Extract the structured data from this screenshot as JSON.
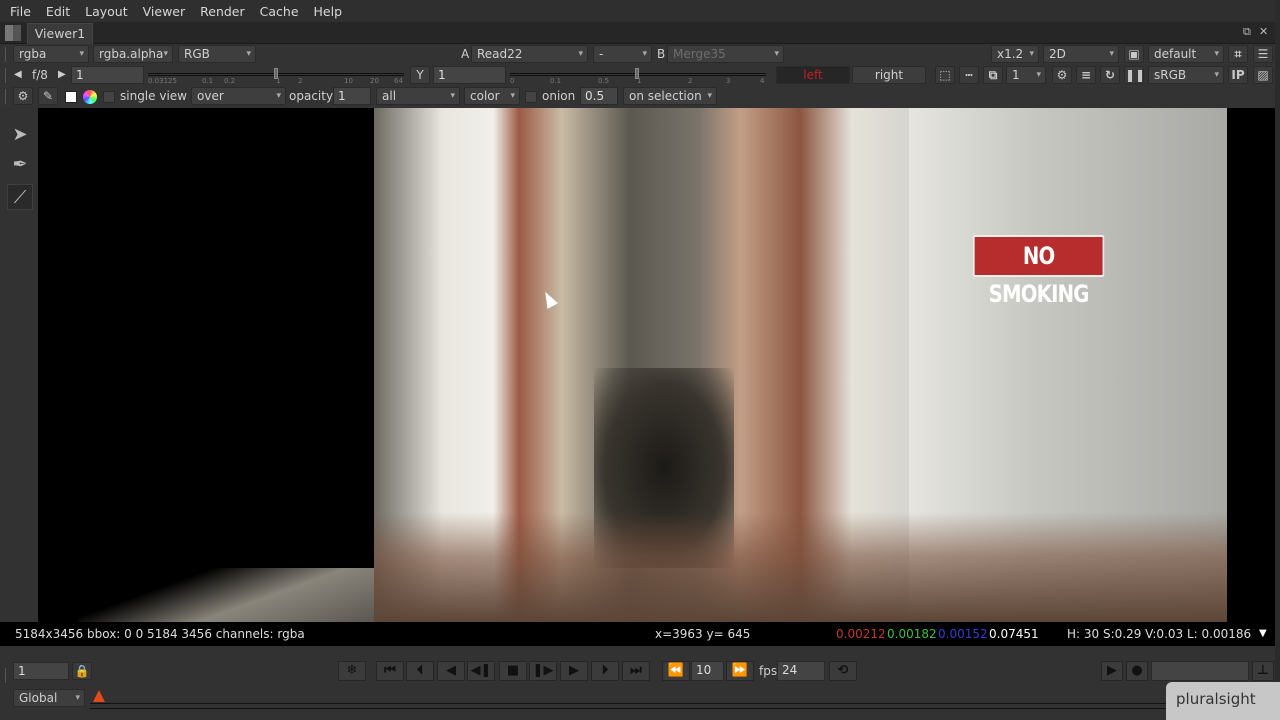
{
  "menu": [
    "File",
    "Edit",
    "Layout",
    "Viewer",
    "Render",
    "Cache",
    "Help"
  ],
  "tab": {
    "label": "Viewer1"
  },
  "row1": {
    "channels": "rgba",
    "alpha_channel": "rgba.alpha",
    "display_channels": "RGB",
    "input_a_label": "A",
    "input_a": "Read22",
    "compare_op": "-",
    "input_b_label": "B",
    "input_b": "Merge35",
    "zoom": "x1.2",
    "view_mode": "2D",
    "lut_preset": "default"
  },
  "row2": {
    "fstop": "f/8",
    "gain": "1",
    "gain_ticks": [
      "0.03125",
      "0.1",
      "0.2",
      "1",
      "2",
      "10",
      "20",
      "64"
    ],
    "gamma_label": "Y",
    "gamma": "1",
    "gamma_ticks": [
      "0",
      "0.1",
      "0.5",
      "1",
      "2",
      "3",
      "4"
    ],
    "left_view": "left",
    "right_view": "right",
    "proxy": "1",
    "colorspace": "sRGB",
    "ip_label": "IP"
  },
  "row3": {
    "single_view_label": "single view",
    "blend_mode": "over",
    "opacity_label": "opacity",
    "opacity": "1",
    "layers": "all",
    "mode": "color",
    "onion_label": "onion",
    "onion_value": "0.5",
    "on_selection": "on selection"
  },
  "image": {
    "sign_text": "NO SMOKING"
  },
  "info": {
    "format": "5184x3456 bbox: 0 0 5184 3456 channels: rgba",
    "coords": "x=3963 y= 645",
    "r": "0.00212",
    "g": "0.00182",
    "b": "0.00152",
    "a": "0.07451",
    "hsvl": "H: 30 S:0.29 V:0.03  L: 0.00186",
    "colors": {
      "r": "#c0392b",
      "g": "#3fbf3f",
      "b": "#3a3acf",
      "a": "#ffffff"
    }
  },
  "transport": {
    "frame": "1",
    "increment": "10",
    "fps_label": "fps",
    "fps": "24",
    "range_mode": "Global",
    "marker_frame": "1"
  },
  "watermark": "pluralsight"
}
